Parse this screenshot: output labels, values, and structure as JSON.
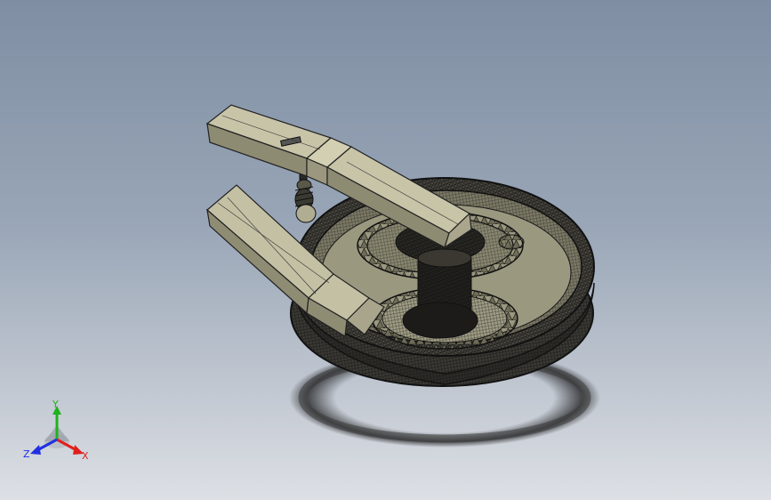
{
  "viewport": {
    "background_top": "#7f8ea3",
    "background_bottom": "#dde0e5",
    "model_color": "#b3b091",
    "wire_color": "#1a1a1a"
  },
  "triad": {
    "x_label": "X",
    "y_label": "Y",
    "z_label": "Z",
    "x_color": "#e0201c",
    "y_color": "#1fb21f",
    "z_color": "#2030e0"
  }
}
